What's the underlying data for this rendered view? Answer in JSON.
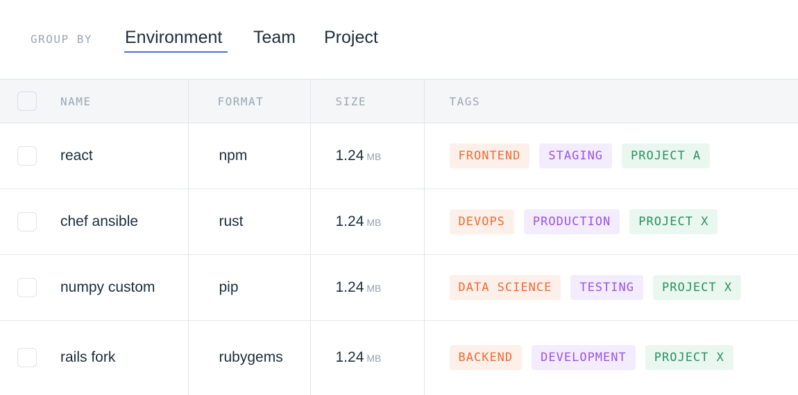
{
  "group_by": {
    "label": "GROUP BY",
    "tabs": [
      "Environment",
      "Team",
      "Project"
    ],
    "active": "Environment"
  },
  "table": {
    "headers": {
      "name": "NAME",
      "format": "FORMAT",
      "size": "SIZE",
      "tags": "TAGS"
    },
    "rows": [
      {
        "name": "react",
        "format": "npm",
        "size": "1.24",
        "unit": "MB",
        "tags": [
          "FRONTEND",
          "STAGING",
          "PROJECT A"
        ]
      },
      {
        "name": "chef ansible",
        "format": "rust",
        "size": "1.24",
        "unit": "MB",
        "tags": [
          "DEVOPS",
          "PRODUCTION",
          "PROJECT X"
        ]
      },
      {
        "name": "numpy custom",
        "format": "pip",
        "size": "1.24",
        "unit": "MB",
        "tags": [
          "DATA SCIENCE",
          "TESTING",
          "PROJECT X"
        ]
      },
      {
        "name": "rails fork",
        "format": "rubygems",
        "size": "1.24",
        "unit": "MB",
        "tags": [
          "BACKEND",
          "DEVELOPMENT",
          "PROJECT X"
        ]
      }
    ]
  },
  "colors": {
    "tag_environment": "#ee6b34",
    "tag_stage": "#9b52e8",
    "tag_project": "#27915c",
    "accent_underline": "#4a72c4"
  }
}
